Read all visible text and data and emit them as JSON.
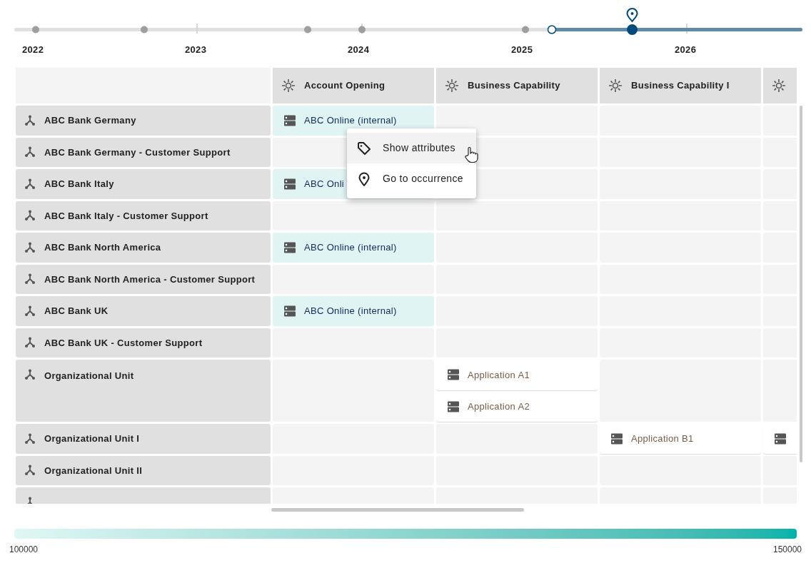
{
  "timeline": {
    "years": [
      "2022",
      "2023",
      "2024",
      "2025",
      "2026"
    ],
    "level": 0.784
  },
  "matrix": {
    "columns": [
      {
        "label": "Account Opening"
      },
      {
        "label": "Business Capability"
      },
      {
        "label": "Business Capability I"
      },
      {}
    ],
    "rows": [
      {
        "label": "ABC Bank Germany",
        "cells": [
          [
            {
              "label": "ABC Online (internal)",
              "color": "#e0f4f4"
            }
          ],
          [],
          [],
          []
        ]
      },
      {
        "label": "ABC Bank Germany - Customer Support",
        "cells": [
          [],
          [],
          [],
          []
        ]
      },
      {
        "label": "ABC Bank Italy",
        "cells": [
          [
            {
              "label": "ABC Onli",
              "color": "#e0f4f4"
            }
          ],
          [],
          [],
          []
        ]
      },
      {
        "label": "ABC Bank Italy - Customer Support",
        "cells": [
          [],
          [],
          [],
          []
        ]
      },
      {
        "label": "ABC Bank North America",
        "cells": [
          [
            {
              "label": "ABC Online (internal)",
              "color": "#e0f4f4"
            }
          ],
          [],
          [],
          []
        ]
      },
      {
        "label": "ABC Bank North America - Customer Support",
        "cells": [
          [],
          [],
          [],
          []
        ]
      },
      {
        "label": "ABC Bank UK",
        "cells": [
          [
            {
              "label": "ABC Online (internal)",
              "color": "#e0f4f4"
            }
          ],
          [],
          [],
          []
        ]
      },
      {
        "label": "ABC Bank UK - Customer Support",
        "cells": [
          [],
          [],
          [],
          []
        ]
      },
      {
        "label": "Organizational Unit",
        "cells": [
          [],
          [
            {
              "label": "Application A1",
              "color": "#ffffff"
            },
            {
              "label": "Application A2",
              "color": "#ffffff"
            }
          ],
          [],
          []
        ]
      },
      {
        "label": "Organizational Unit I",
        "cells": [
          [],
          [],
          [
            {
              "label": "Application B1",
              "color": "#ffffff"
            }
          ],
          [
            {
              "color": "#ffffff"
            }
          ]
        ]
      },
      {
        "label": "Organizational Unit II",
        "cells": [
          [],
          [],
          [],
          []
        ]
      },
      {
        "cells": [
          [],
          [],
          [],
          []
        ]
      }
    ]
  },
  "context_menu": {
    "items": [
      {
        "kind": "tag",
        "label": "Show attributes",
        "selected": true
      },
      {
        "kind": "pin",
        "label": "Go to occurrence",
        "selected": false
      }
    ]
  },
  "legend": {
    "min": "100000",
    "max": "150000"
  }
}
